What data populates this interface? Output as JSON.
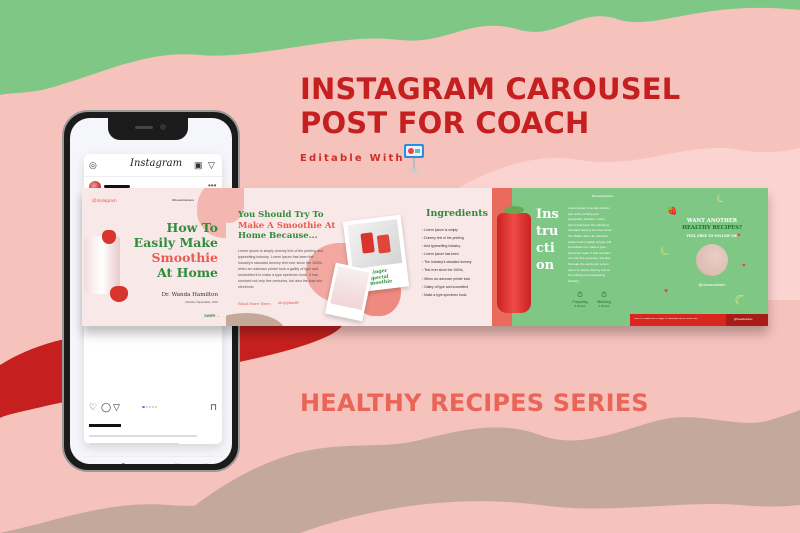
{
  "header": {
    "title_line1": "INSTAGRAM CAROUSEL",
    "title_line2": "POST FOR COACH",
    "editable_label": "Editable With",
    "editable_app_icon": "keynote-icon"
  },
  "footer": {
    "series_label": "HEALTHY RECIPES SERIES"
  },
  "colors": {
    "background": "#f6c2bc",
    "title_red": "#c5201f",
    "series_coral": "#ea6558",
    "accent_green": "#7ec785",
    "heading_green": "#2f8c3c"
  },
  "phone": {
    "app_name": "Instagram",
    "header_icons": [
      "camera-icon",
      "igtv-icon",
      "direct-message-icon"
    ],
    "more_label": "•••",
    "post_action_icons": [
      "heart-icon",
      "comment-icon",
      "share-icon",
      "bookmark-icon"
    ],
    "carousel_dots": 5,
    "carousel_active_dot": 1,
    "nav_icons": [
      "home-icon",
      "search-icon",
      "add-post-icon",
      "activity-heart-icon",
      "profile-icon"
    ]
  },
  "carousel": {
    "slide1": {
      "handle": "@Instagram",
      "site": "#thewebsitehere",
      "title_line1": "How To",
      "title_line2": "Easily Make",
      "title_line3": "Smoothie",
      "title_line4": "At Home",
      "author": "Dr. Wanda Hamilton",
      "author_role": "Nutrition Specialist, USA",
      "swipe": "SWIPE →"
    },
    "slide2": {
      "title_line1": "You Should Try To",
      "title_line2": "Make A Smoothie At",
      "title_line3": "Home Because...",
      "body": "Lorem Ipsum is simply dummy text of the printing and typesetting industry. Lorem Ipsum has been the industry's standard dummy text ever since the 1500s, when an unknown printer took a galley of type and scrambled it to make a type specimen book. It has survived not only five centuries, but also the leap into electronic.",
      "read_more": "Read More Here :",
      "link": "bit.ly/y6ax8F",
      "photo_caption_line1": "Ginger",
      "photo_caption_line2": "Special",
      "photo_caption_line3": "Smoothie"
    },
    "slide3": {
      "title": "Ingredients",
      "items": [
        "Lorem Ipsum is simply",
        "Dummy text of the printing",
        "And typesetting industry.",
        "Lorem Ipsum has been",
        "The Industry's standard dummy",
        "Text ever since the 1500s,",
        "When an unknown printer took",
        "Galley of type and scrambled",
        "Make a type specimen book."
      ]
    },
    "slide4": {
      "title_parts": [
        "Ins",
        "tru",
        "cti",
        "on"
      ],
      "site": "#thewebsitehere",
      "body": "Lorem Ipsum is simply dummy text of the printing and typesetting industry. Lorem Ipsum has been the industry's standard dummy text ever since the 1500s, when an unknown printer took a galley of type and scrambled it to make a type specimen book. It has survived not only five centuries, but also the leap into electronic Lorem Ipsum is simply dummy text of the printing and typesetting industry.",
      "timers": [
        {
          "label": "Preparing",
          "value": "5 Minute"
        },
        {
          "label": "Blending",
          "value": "3 Minute"
        }
      ]
    },
    "slide5": {
      "title_line1": "WANT ANOTHER",
      "title_line2": "HEALTHY RECIPES?",
      "subtitle": "FEEL FREE TO FOLLOW ME",
      "handle": "@drwandaham",
      "banner_text": "Hold On, Please Don't Forget To Subscribe Me For Other Post",
      "banner_handle": "@thewebsitehere"
    }
  }
}
